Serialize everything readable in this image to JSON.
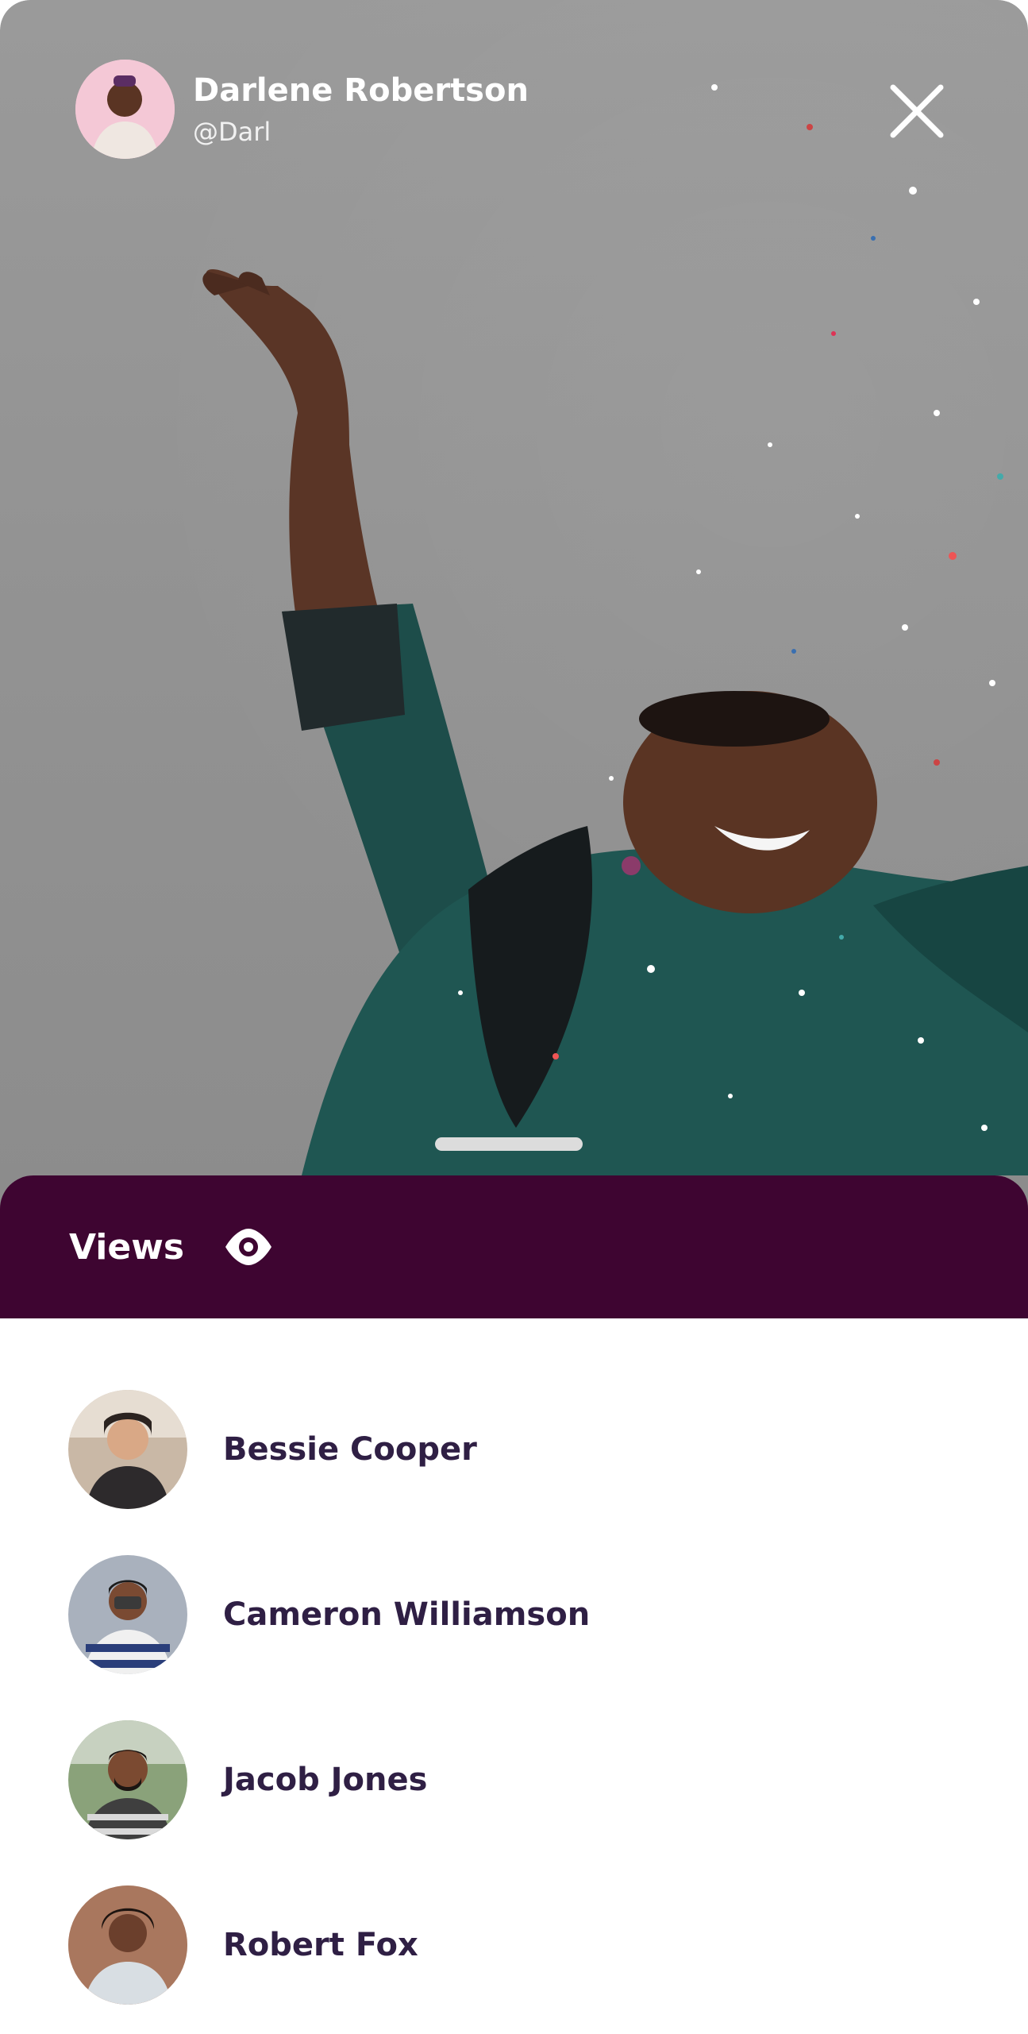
{
  "story": {
    "author_name": "Darlene Robertson",
    "author_handle": "@Darl",
    "author_avatar_icon": "author-avatar-icon",
    "close_icon": "close-icon",
    "photo": "confetti-celebration-photo"
  },
  "views": {
    "label": "Views",
    "icon": "eye-icon",
    "panel_color": "#3e0531"
  },
  "viewers": [
    {
      "name": "Bessie Cooper"
    },
    {
      "name": "Cameron Williamson"
    },
    {
      "name": "Jacob Jones"
    },
    {
      "name": "Robert Fox"
    }
  ],
  "colors": {
    "name_text": "#2f1f44",
    "story_bg": "#939393"
  }
}
